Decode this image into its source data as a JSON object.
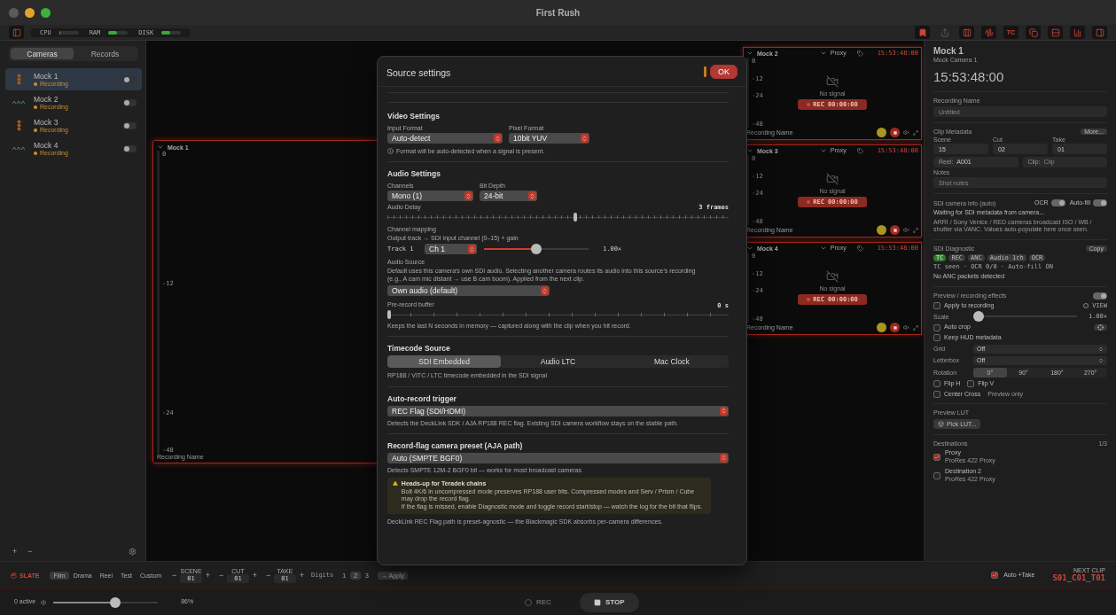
{
  "window": {
    "title": "First Rush"
  },
  "toolbar": {
    "meters": [
      {
        "label": "CPU",
        "level": 0.08
      },
      {
        "label": "RAM",
        "level": 0.45
      },
      {
        "label": "DISK",
        "level": 0.45
      }
    ],
    "tools": [
      {
        "kind": "bookmark",
        "disabled": false
      },
      {
        "kind": "share",
        "disabled": true
      },
      {
        "kind": "columns",
        "disabled": false
      },
      {
        "kind": "waveform",
        "disabled": false
      },
      {
        "kind": "text",
        "label": "TC",
        "disabled": false
      },
      {
        "kind": "copy",
        "disabled": false
      },
      {
        "kind": "rows",
        "disabled": false
      },
      {
        "kind": "bars",
        "disabled": false
      },
      {
        "kind": "panel",
        "disabled": false
      }
    ]
  },
  "sidebar": {
    "tabs": [
      {
        "label": "Cameras",
        "selected": true
      },
      {
        "label": "Records",
        "selected": false
      }
    ],
    "cameras": [
      {
        "name": "Mock 1",
        "status": "Recording",
        "kind": "meter",
        "selected": true,
        "on": false
      },
      {
        "name": "Mock 2",
        "status": "Recording",
        "kind": "wave",
        "selected": false,
        "on": false
      },
      {
        "name": "Mock 3",
        "status": "Recording",
        "kind": "meter",
        "selected": false,
        "on": false
      },
      {
        "name": "Mock 4",
        "status": "Recording",
        "kind": "wave",
        "selected": false,
        "on": false
      }
    ],
    "footer": {
      "add": "+",
      "remove": "−"
    }
  },
  "main_panel": {
    "name": "Mock 1",
    "scale": [
      "0",
      "-12",
      "-24",
      "-48"
    ],
    "recording_name": "Recording Name"
  },
  "monitors": [
    {
      "name": "Mock 2",
      "output": "Proxy",
      "timecode": "15:53:48:00",
      "scale": [
        "0",
        "-12",
        "-24",
        "-48"
      ],
      "signal": "No signal",
      "rec": "REC 00:00:00",
      "recording_name": "Recording Name"
    },
    {
      "name": "Mock 3",
      "output": "Proxy",
      "timecode": "15:53:48:00",
      "scale": [
        "0",
        "-12",
        "-24",
        "-48"
      ],
      "signal": "No signal",
      "rec": "REC 00:00:00",
      "recording_name": "Recording Name"
    },
    {
      "name": "Mock 4",
      "output": "Proxy",
      "timecode": "15:53:48:00",
      "scale": [
        "0",
        "-12",
        "-24",
        "-48"
      ],
      "signal": "No signal",
      "rec": "REC 00:00:00",
      "recording_name": "Recording Name"
    }
  ],
  "inspector": {
    "title": "Mock 1",
    "subtitle": "Mock Camera 1",
    "timecode": "15:53:48:00",
    "recording_name": {
      "label": "Recording Name",
      "placeholder": "Untitled"
    },
    "clip": {
      "label": "Clip Metadata",
      "more": "More...",
      "fields": [
        {
          "label": "Scene",
          "value": "15"
        },
        {
          "label": "Cut",
          "value": "02"
        },
        {
          "label": "Take",
          "value": "01"
        }
      ],
      "reel": {
        "label": "Reel:",
        "value": "A001"
      },
      "clip": {
        "label": "Clip:",
        "placeholder": "Clip"
      },
      "notes": {
        "label": "Notes",
        "placeholder": "Shot notes"
      }
    },
    "sdi_info": {
      "label": "SDI camera info (auto)",
      "toggles": [
        {
          "label": "OCR",
          "on": true
        },
        {
          "label": "Auto-fill",
          "on": true
        }
      ],
      "status": "Waiting for SDI metadata from camera...",
      "description": "ARRI / Sony Venice / RED cameras broadcast ISO / WB / shutter via VANC. Values auto-populate here once seen."
    },
    "diagnostic": {
      "label": "SDI Diagnostic",
      "copy": "Copy",
      "chips": [
        {
          "label": "TC",
          "on": true
        },
        {
          "label": "REC",
          "on": false
        },
        {
          "label": "ANC",
          "on": false
        },
        {
          "label": "Audio 1ch",
          "on": false
        },
        {
          "label": "OCR",
          "on": false
        }
      ],
      "summary": "TC seen · OCR 0/0 · Auto-fill ON",
      "packets": "No ANC packets detected"
    },
    "effects": {
      "label": "Preview / recording effects",
      "on": true,
      "apply": {
        "label": "Apply to recording",
        "checked": false
      },
      "view": {
        "label": "VIEW",
        "selected": false
      },
      "scale": {
        "label": "Scale",
        "level": 0,
        "reading": "1.00×"
      },
      "auto_crop": {
        "label": "Auto crop",
        "checked": false
      },
      "keep_hud": {
        "label": "Keep HUD metadata",
        "checked": false
      },
      "grid": {
        "label": "Grid",
        "value": "Off"
      },
      "letterbox": {
        "label": "Letterbox",
        "value": "Off"
      },
      "rotation": {
        "label": "Rotation",
        "options": [
          {
            "label": "0°",
            "selected": true
          },
          {
            "label": "90°",
            "selected": false
          },
          {
            "label": "180°",
            "selected": false
          },
          {
            "label": "270°",
            "selected": false
          }
        ]
      },
      "flips": [
        {
          "label": "Flip H",
          "checked": false
        },
        {
          "label": "Flip V",
          "checked": false
        }
      ],
      "center_cross": {
        "label": "Center Cross",
        "checked": false,
        "note": "Preview only"
      }
    },
    "lut": {
      "label": "Preview LUT",
      "button": "Pick LUT..."
    },
    "destinations": {
      "label": "Destinations",
      "count": "1/3",
      "items": [
        {
          "name": "Proxy",
          "format": "ProRes 422 Proxy",
          "checked": true
        },
        {
          "name": "Destination 2",
          "format": "ProRes 422 Proxy",
          "checked": false
        }
      ]
    }
  },
  "modal": {
    "title": "Source settings",
    "ok": "OK",
    "video": {
      "title": "Video Settings",
      "input_format": {
        "label": "Input Format",
        "value": "Auto-detect"
      },
      "pixel_format": {
        "label": "Pixel Format",
        "value": "10bit YUV"
      },
      "info": "Format will be auto-detected when a signal is present."
    },
    "audio": {
      "title": "Audio Settings",
      "channels": {
        "label": "Channels",
        "value": "Mono (1)"
      },
      "bit_depth": {
        "label": "Bit Depth",
        "value": "24-bit"
      },
      "delay": {
        "label": "Audio Delay",
        "reading": "3 frames",
        "level": 0.55
      },
      "mapping": {
        "label": "Channel mapping",
        "hint": "Output track → SDI input channel (0–15) + gain",
        "tracks": [
          {
            "label": "Track 1",
            "channel": "Ch 1",
            "level": 0.5,
            "reading": "1.00×"
          }
        ]
      },
      "source": {
        "label": "Audio Source",
        "description": "Default uses this camera's own SDI audio. Selecting another camera routes its audio into this source's recording (e.g., A cam mic distant → use B cam boom). Applied from the next clip.",
        "value": "Own audio (default)"
      },
      "prerecord": {
        "label": "Pre-record buffer",
        "reading": "0 s",
        "level": 0,
        "hint": "Keeps the last N seconds in memory — captured along with the clip when you hit record."
      }
    },
    "timecode": {
      "title": "Timecode Source",
      "options": [
        {
          "label": "SDI Embedded",
          "selected": true
        },
        {
          "label": "Audio LTC",
          "selected": false
        },
        {
          "label": "Mac Clock",
          "selected": false
        }
      ],
      "hint": "RP188 / VITC / LTC timecode embedded in the SDI signal"
    },
    "trigger": {
      "title": "Auto-record trigger",
      "value": "REC Flag (SDI/HDMI)",
      "hint": "Detects the DeckLink SDK / AJA RP188 REC flag. Existing SDI camera workflow stays on the stable path."
    },
    "preset": {
      "title": "Record-flag camera preset (AJA path)",
      "value": "Auto (SMPTE BGF0)",
      "hint": "Detects SMPTE 12M-2 BGF0 bit — works for most broadcast cameras",
      "warning": {
        "title": "Heads-up for Teradek chains",
        "lines": [
          "Bolt 4K/6 in uncompressed mode preserves RP188 user bits. Compressed modes and Serv / Prism / Cube may drop the record flag.",
          "If the flag is missed, enable Diagnostic mode and toggle record start/stop — watch the log for the bit that flips."
        ]
      },
      "note": "DeckLink REC Flag path is preset-agnostic — the Blackmagic SDK absorbs per-camera differences."
    }
  },
  "slate": {
    "label": "SLATE",
    "modes": [
      {
        "label": "Film",
        "selected": true
      },
      {
        "label": "Drama",
        "selected": false
      },
      {
        "label": "Reel",
        "selected": false
      },
      {
        "label": "Test",
        "selected": false
      },
      {
        "label": "Custom",
        "selected": false
      }
    ],
    "counters": [
      {
        "label": "SCENE",
        "value": "01",
        "minus": "−",
        "plus": "+"
      },
      {
        "label": "CUT",
        "value": "01",
        "minus": "−",
        "plus": "+"
      },
      {
        "label": "TAKE",
        "value": "01",
        "minus": "−",
        "plus": "+"
      }
    ],
    "digits": {
      "label": "Digits",
      "options": [
        {
          "label": "1",
          "selected": false
        },
        {
          "label": "2",
          "selected": true
        },
        {
          "label": "3",
          "selected": false
        }
      ]
    },
    "apply": "→ Apply",
    "auto_take": {
      "label": "Auto +Take",
      "checked": true
    },
    "next_clip": {
      "label": "NEXT CLIP",
      "value": "S01_C01_T01"
    }
  },
  "transport": {
    "active": "0 active",
    "volume": {
      "level": 0.6,
      "reading": "86%"
    },
    "rec": {
      "label": "REC",
      "disabled": true
    },
    "stop": {
      "label": "STOP",
      "disabled": false
    }
  }
}
